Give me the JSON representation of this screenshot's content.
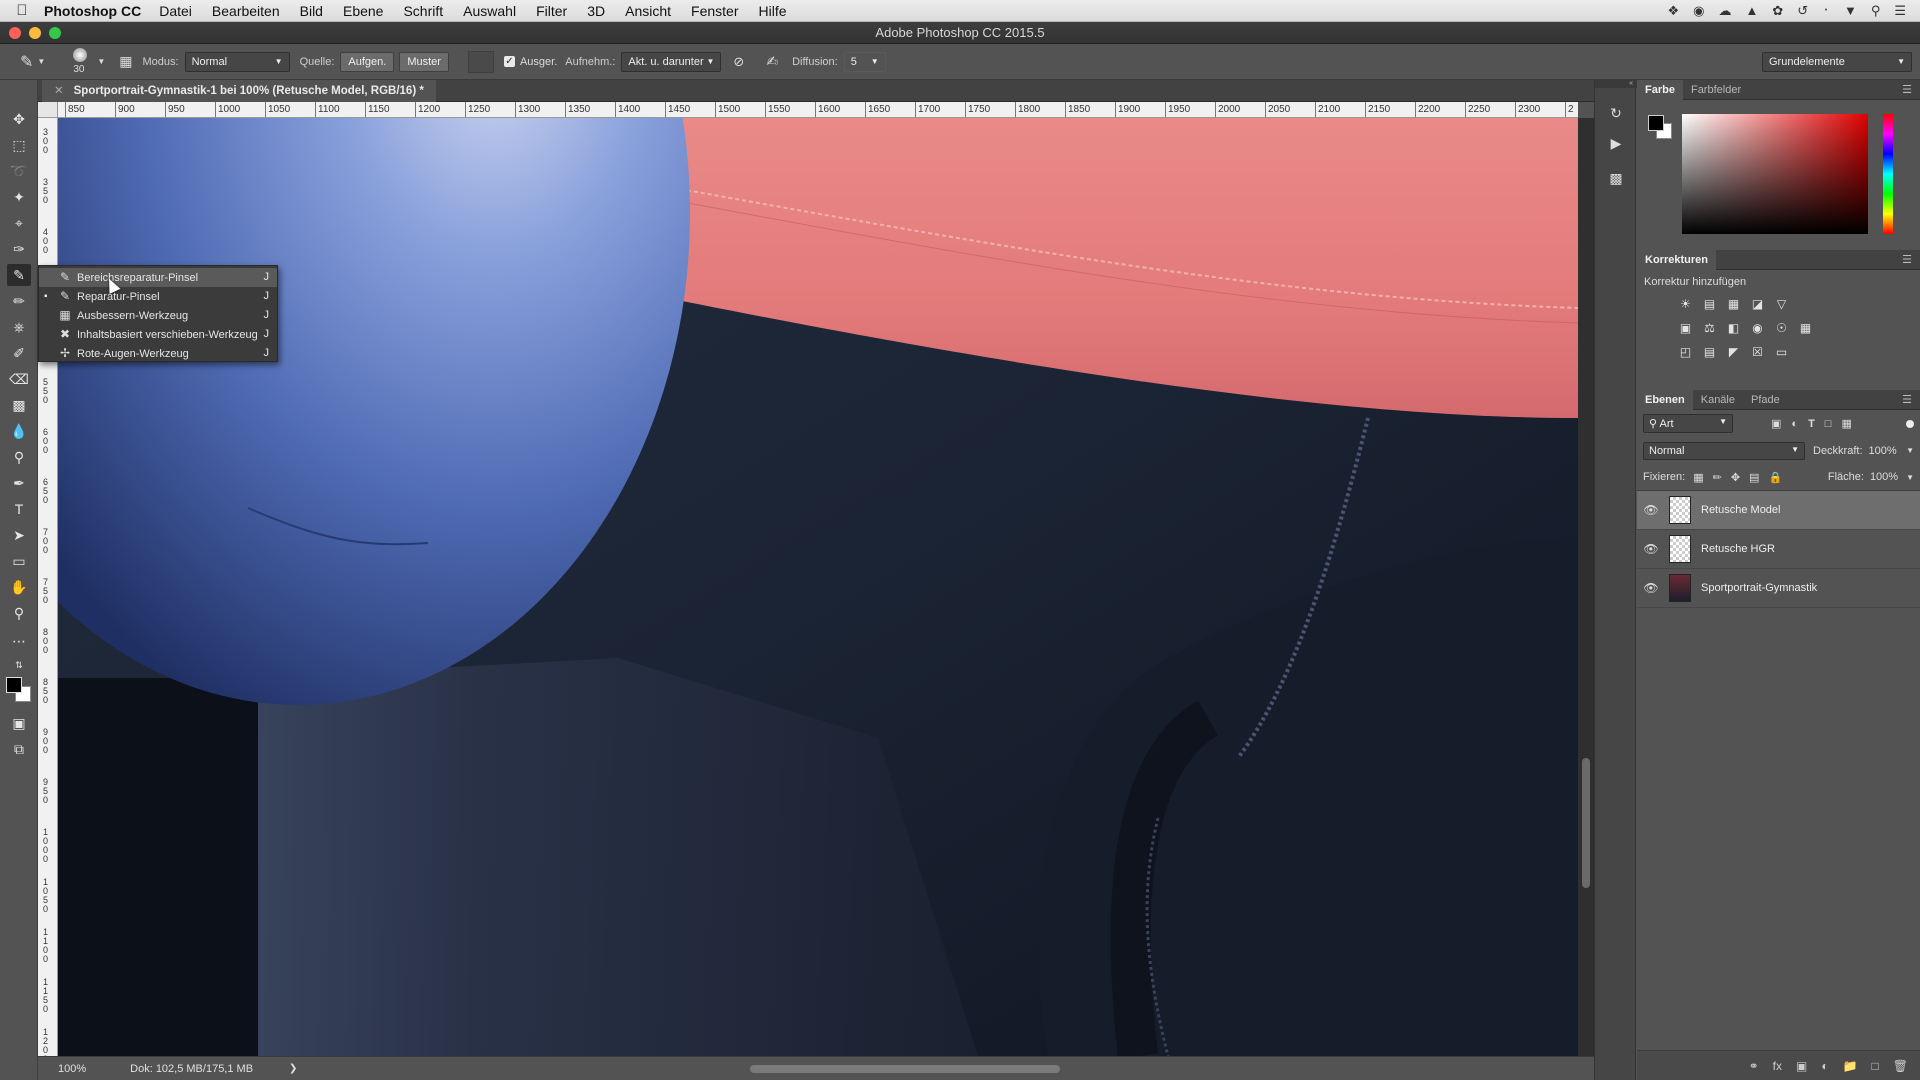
{
  "menubar": {
    "app": "Photoshop CC",
    "items": [
      "Datei",
      "Bearbeiten",
      "Bild",
      "Ebene",
      "Schrift",
      "Auswahl",
      "Filter",
      "3D",
      "Ansicht",
      "Fenster",
      "Hilfe"
    ]
  },
  "window": {
    "title": "Adobe Photoshop CC 2015.5"
  },
  "options": {
    "brush_size": "30",
    "modus_label": "Modus:",
    "modus_value": "Normal",
    "quelle_label": "Quelle:",
    "aufgen_label": "Aufgen.",
    "muster_label": "Muster",
    "ausger_label": "Ausger.",
    "aufnehm_label": "Aufnehm.:",
    "aufnehm_value": "Akt. u. darunter",
    "diffusion_label": "Diffusion:",
    "diffusion_value": "5",
    "workspace": "Grundelemente"
  },
  "document": {
    "tab_title": "Sportportrait-Gymnastik-1 bei 100% (Retusche Model, RGB/16) *",
    "zoom": "100%",
    "doc_info": "Dok: 102,5 MB/175,1 MB"
  },
  "ruler": {
    "h_ticks": [
      "850",
      "900",
      "950",
      "1000",
      "1050",
      "1100",
      "1150",
      "1200",
      "1250",
      "1300",
      "1350",
      "1400",
      "1450",
      "1500",
      "1550",
      "1600",
      "1650",
      "1700",
      "1750",
      "1800",
      "1850",
      "1900",
      "1950",
      "2000",
      "2050",
      "2100",
      "2150",
      "2200",
      "2250",
      "2300",
      "2"
    ],
    "v_ticks": [
      "3\n0\n0",
      "3\n5\n0",
      "4\n0\n0",
      "4\n5\n0",
      "5\n0\n0",
      "5\n5\n0",
      "6\n0\n0",
      "6\n5\n0",
      "7\n0\n0",
      "7\n5\n0",
      "8\n0\n0",
      "8\n5\n0",
      "9\n0\n0",
      "9\n5\n0",
      "1\n0\n0\n0",
      "1\n0\n5\n0",
      "1\n1\n0\n0",
      "1\n1\n5\n0",
      "1\n2\n0\n0"
    ]
  },
  "flyout": {
    "items": [
      {
        "label": "Bereichsreparatur-Pinsel",
        "shortcut": "J",
        "icon": "spot-healing-icon",
        "selected": false,
        "hover": true
      },
      {
        "label": "Reparatur-Pinsel",
        "shortcut": "J",
        "icon": "healing-brush-icon",
        "selected": true,
        "hover": false
      },
      {
        "label": "Ausbessern-Werkzeug",
        "shortcut": "J",
        "icon": "patch-icon",
        "selected": false,
        "hover": false
      },
      {
        "label": "Inhaltsbasiert verschieben-Werkzeug",
        "shortcut": "J",
        "icon": "content-aware-move-icon",
        "selected": false,
        "hover": false
      },
      {
        "label": "Rote-Augen-Werkzeug",
        "shortcut": "J",
        "icon": "red-eye-icon",
        "selected": false,
        "hover": false
      }
    ]
  },
  "panels": {
    "color_tabs": [
      "Farbe",
      "Farbfelder"
    ],
    "korrekturen_title": "Korrekturen",
    "korrektur_add": "Korrektur hinzufügen",
    "layer_tabs": [
      "Ebenen",
      "Kanäle",
      "Pfade"
    ],
    "filter_kind": "Art",
    "blend_mode": "Normal",
    "deckkraft_label": "Deckkraft:",
    "deckkraft_value": "100%",
    "fixieren_label": "Fixieren:",
    "flaeche_label": "Fläche:",
    "flaeche_value": "100%",
    "layers": [
      {
        "name": "Retusche Model",
        "selected": true
      },
      {
        "name": "Retusche HGR",
        "selected": false
      },
      {
        "name": "Sportportrait-Gymnastik",
        "selected": false
      }
    ]
  },
  "colors": {
    "accent_select": "#6e6e6e",
    "shirt": "#e07c7c",
    "ball": "#5a7fc8",
    "pants": "#1b2333"
  }
}
